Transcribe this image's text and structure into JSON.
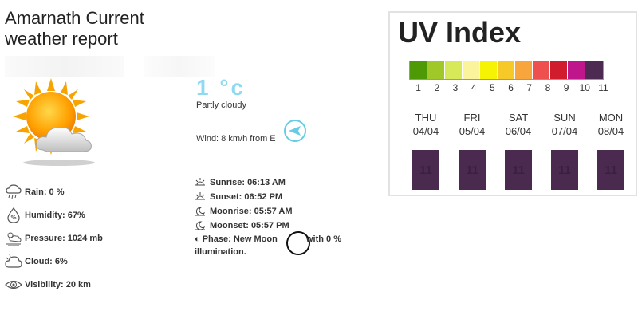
{
  "header": {
    "title_line1": "Amarnath Current",
    "title_line2": "weather report"
  },
  "current": {
    "temperature": "1 °c",
    "condition": "Partly cloudy",
    "wind": "Wind: 8 km/h from E",
    "icon": "partly-cloudy-sun-icon"
  },
  "stats": [
    {
      "label": "Rain: 0 %",
      "icon": "rain-icon"
    },
    {
      "label": "Humidity: 67%",
      "icon": "humidity-icon"
    },
    {
      "label": "Pressure: 1024 mb",
      "icon": "pressure-icon"
    },
    {
      "label": "Cloud: 6%",
      "icon": "cloud-icon"
    },
    {
      "label": "Visibility: 20 km",
      "icon": "eye-icon"
    }
  ],
  "astronomy": {
    "sunrise": "Sunrise: 06:13 AM",
    "sunset": "Sunset: 06:52 PM",
    "moonrise": "Moonrise: 05:57 AM",
    "moonset": "Moonset: 05:57 PM",
    "phase_prefix": "Phase: New Moon",
    "phase_suffix": "with 0 %",
    "phase_line2": "illumination."
  },
  "uv": {
    "title": "UV Index",
    "scale_colors": [
      "#4e9a06",
      "#a0c828",
      "#d7e858",
      "#fcf49c",
      "#f7f304",
      "#f6c928",
      "#f7a53c",
      "#ee5050",
      "#d01c2c",
      "#c0168c",
      "#4d2a52"
    ],
    "scale_labels": [
      "1",
      "2",
      "3",
      "4",
      "5",
      "6",
      "7",
      "8",
      "9",
      "10",
      "11"
    ],
    "forecast": [
      {
        "day": "THU",
        "date": "04/04",
        "value": "11"
      },
      {
        "day": "FRI",
        "date": "05/04",
        "value": "11"
      },
      {
        "day": "SAT",
        "date": "06/04",
        "value": "11"
      },
      {
        "day": "SUN",
        "date": "07/04",
        "value": "11"
      },
      {
        "day": "MON",
        "date": "08/04",
        "value": "11"
      }
    ]
  }
}
